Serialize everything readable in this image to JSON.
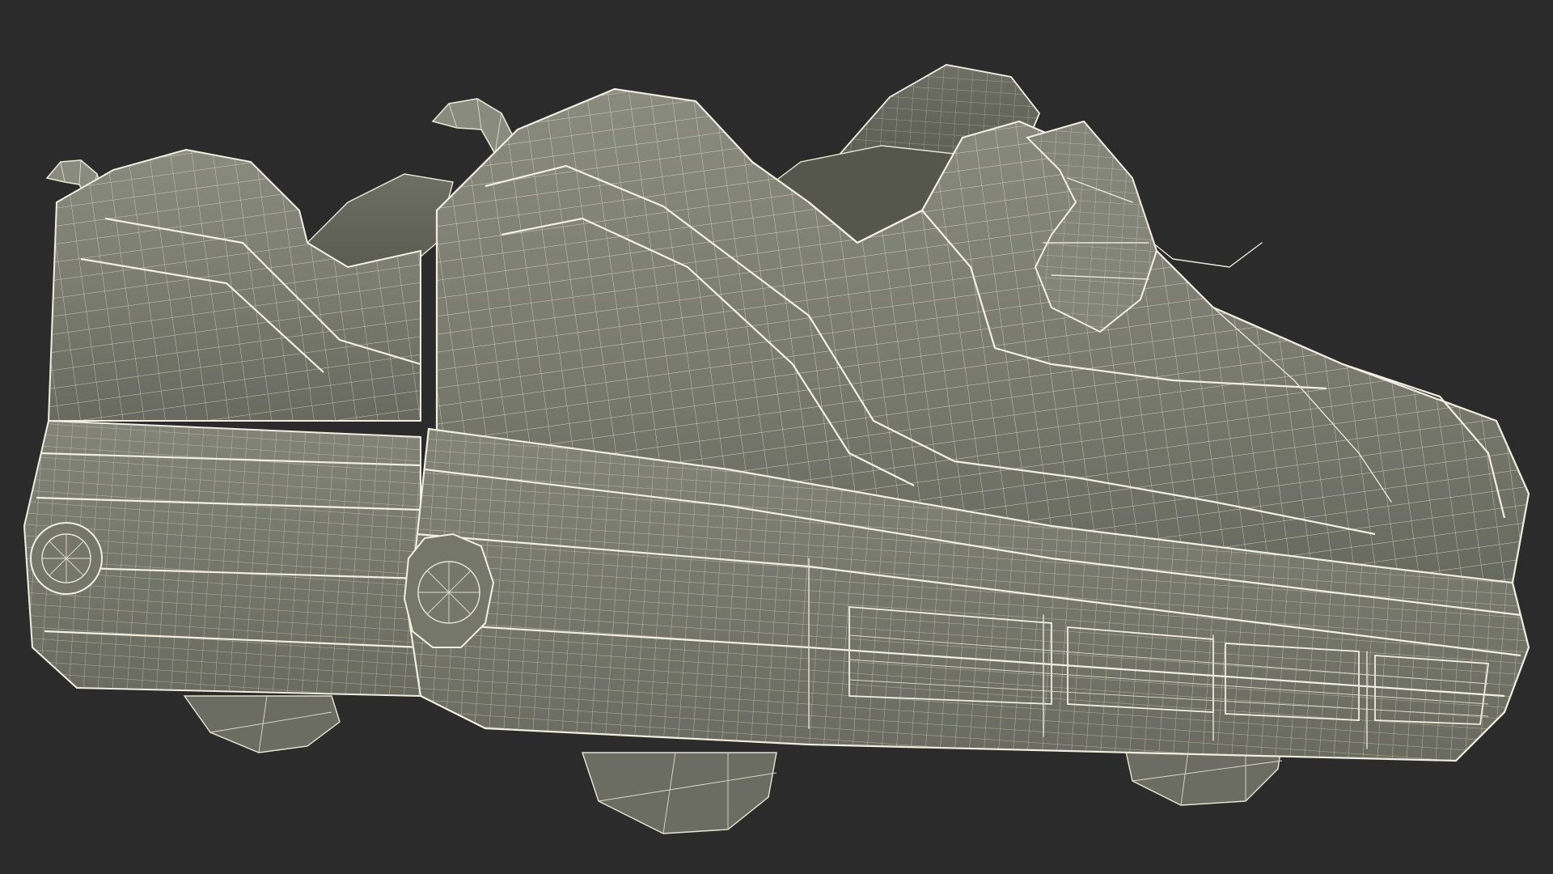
{
  "scene": {
    "background_color": "#2b2b2b",
    "mesh_fill_color": "#7b7c70",
    "mesh_shadow_color": "#5f6056",
    "wire_color": "#e8e6d6",
    "subject": "wireframe-sneakers-with-heel-wheels"
  }
}
